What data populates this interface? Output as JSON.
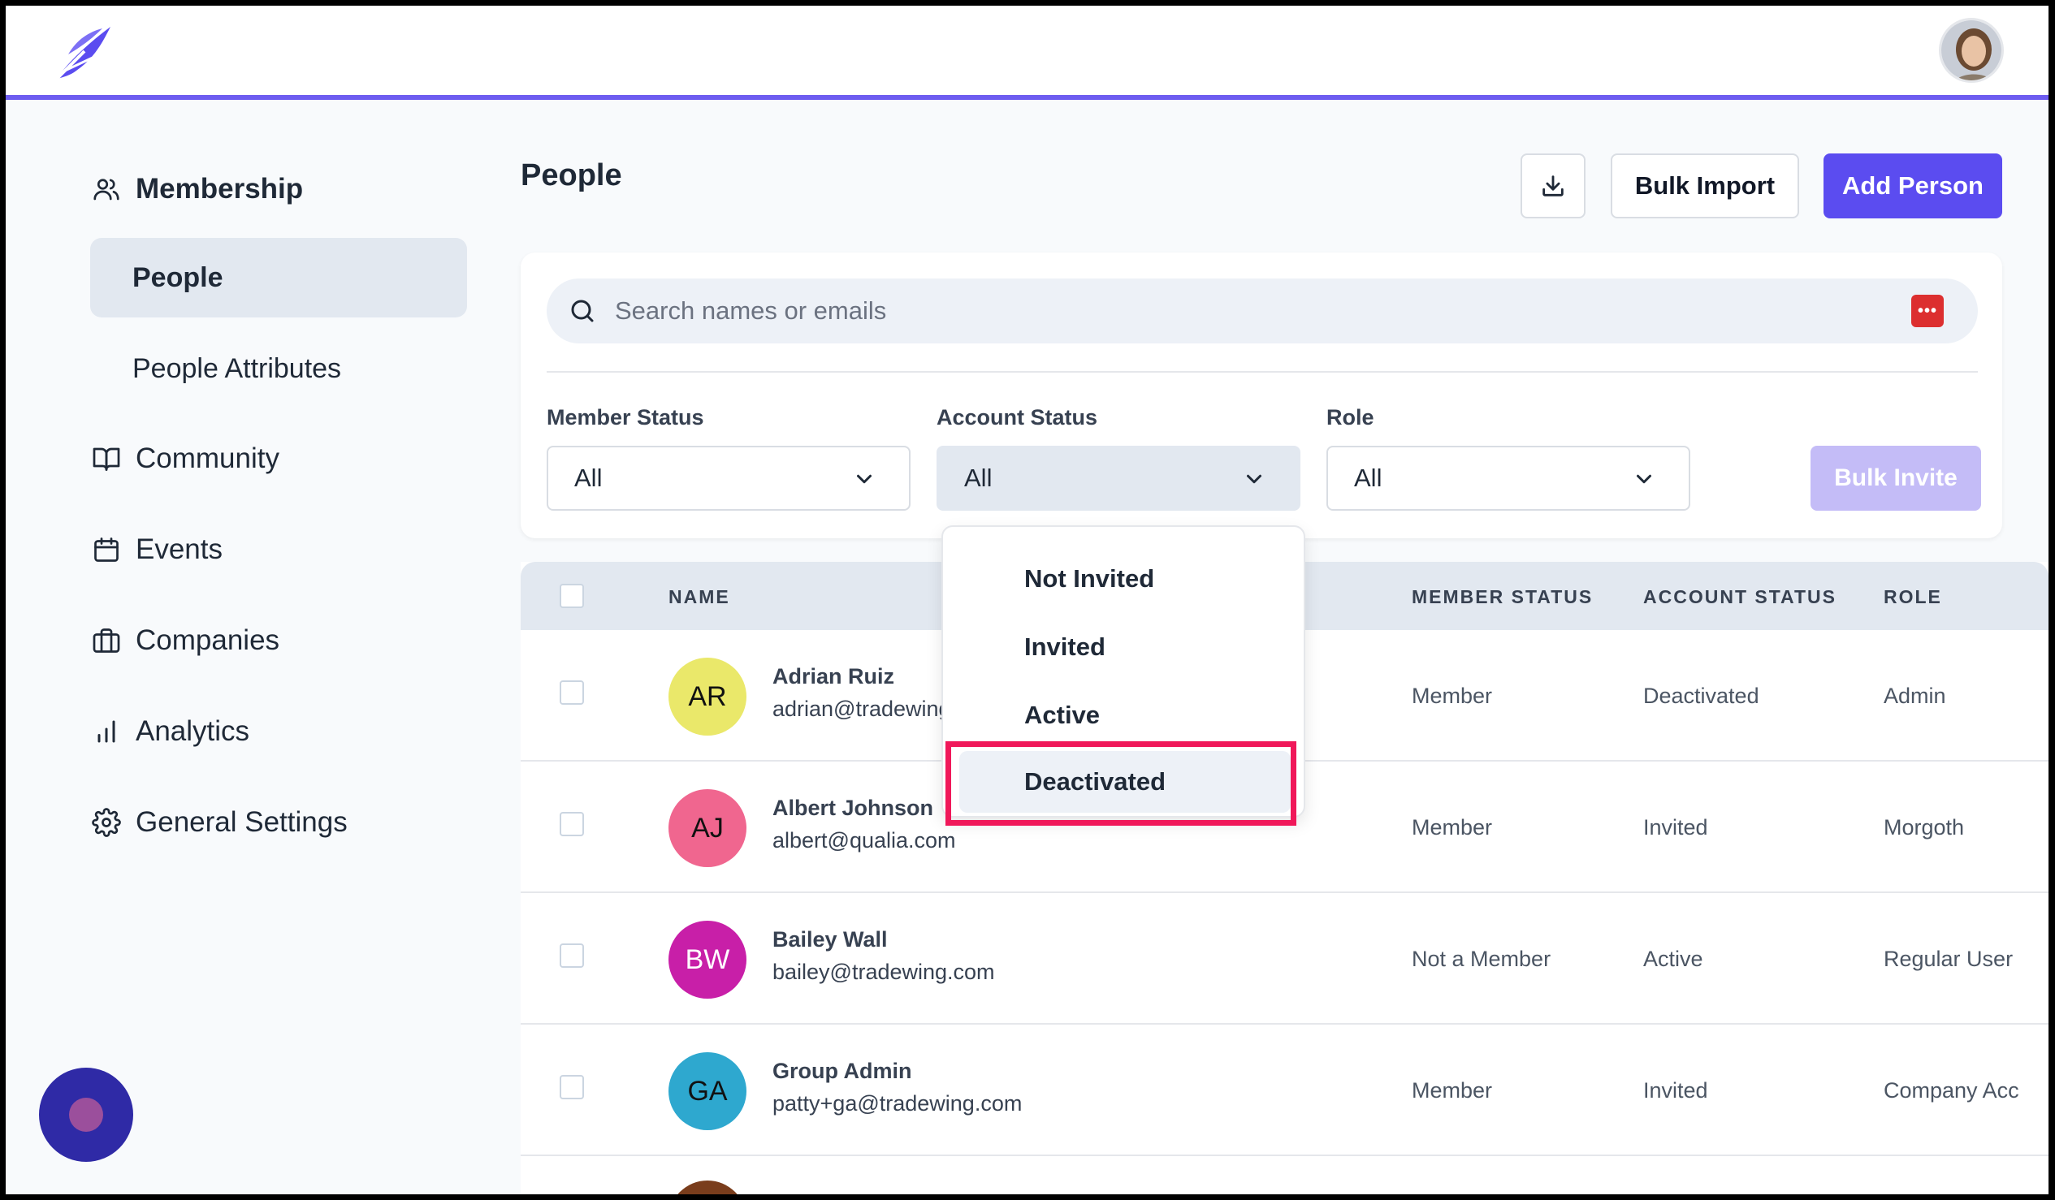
{
  "sidebar": {
    "membership": "Membership",
    "people": "People",
    "people_attributes": "People Attributes",
    "community": "Community",
    "events": "Events",
    "companies": "Companies",
    "analytics": "Analytics",
    "general_settings": "General Settings"
  },
  "header": {
    "title": "People",
    "bulk_import": "Bulk Import",
    "add_person": "Add Person"
  },
  "filters": {
    "search_placeholder": "Search names or emails",
    "member_status_label": "Member Status",
    "member_status_value": "All",
    "account_status_label": "Account Status",
    "account_status_value": "All",
    "role_label": "Role",
    "role_value": "All",
    "bulk_invite": "Bulk Invite"
  },
  "dropdown": {
    "options": [
      "Not Invited",
      "Invited",
      "Active",
      "Deactivated"
    ]
  },
  "table": {
    "headers": {
      "name": "NAME",
      "member_status": "MEMBER STATUS",
      "account_status": "ACCOUNT STATUS",
      "role": "ROLE"
    },
    "rows": [
      {
        "initials": "AR",
        "name": "Adrian Ruiz",
        "email": "adrian@tradewing.com",
        "member_status": "Member",
        "account_status": "Deactivated",
        "role": "Admin",
        "color": "#eae86a"
      },
      {
        "initials": "AJ",
        "name": "Albert Johnson",
        "email": "albert@qualia.com",
        "member_status": "Member",
        "account_status": "Invited",
        "role": "Morgoth",
        "color": "#f0668f"
      },
      {
        "initials": "BW",
        "name": "Bailey Wall",
        "email": "bailey@tradewing.com",
        "member_status": "Not a Member",
        "account_status": "Active",
        "role": "Regular User",
        "color": "#c81fa8"
      },
      {
        "initials": "GA",
        "name": "Group Admin",
        "email": "patty+ga@tradewing.com",
        "member_status": "Member",
        "account_status": "Invited",
        "role": "Company Acc",
        "color": "#2ea8cf"
      }
    ]
  },
  "colors": {
    "accent": "#5b4cf0",
    "highlight": "#f0185a"
  }
}
